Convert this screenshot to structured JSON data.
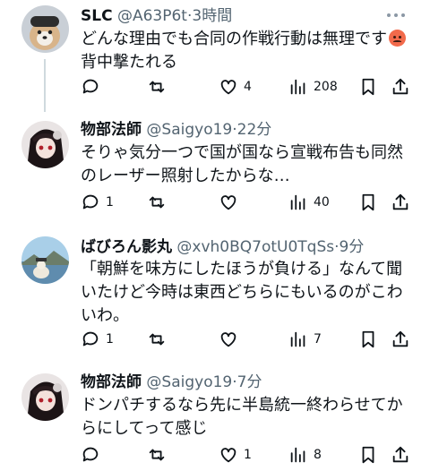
{
  "posts": [
    {
      "name": "SLC",
      "handle": "@A63P6t",
      "time": "3時間",
      "text_lines": [
        "どんな理由でも合同の作戦行動は無理です",
        "背中撃たれる"
      ],
      "emoji": "angry-face",
      "replies": "",
      "reposts": "",
      "likes": "4",
      "views": "208"
    },
    {
      "name": "物部法師",
      "handle": "@Saigyo19",
      "time": "22分",
      "text_lines": [
        "そりゃ気分一つで国が国なら宣戦布告も同然",
        "のレーザー照射したからな…"
      ],
      "replies": "1",
      "reposts": "",
      "likes": "",
      "views": "40"
    },
    {
      "name": "ばびろん影丸",
      "handle": "@xvh0BQ7otU0TqSs",
      "time": "9分",
      "text_lines": [
        "「朝鮮を味方にしたほうが負ける」なんて聞",
        "いたけど今時は東西どちらにもいるのがこわ",
        "いわ。"
      ],
      "replies": "1",
      "reposts": "",
      "likes": "",
      "views": "7"
    },
    {
      "name": "物部法師",
      "handle": "@Saigyo19",
      "time": "7分",
      "text_lines": [
        "ドンパチするなら先に半島統一終わらせてか",
        "らにしてって感じ"
      ],
      "replies": "",
      "reposts": "",
      "likes": "1",
      "views": "8"
    }
  ],
  "separator": "·",
  "colors": {
    "text": "#0f1419",
    "meta": "#536471",
    "thread_line": "#cfd9de",
    "emoji": "#f26a4b"
  },
  "icons": [
    "reply-icon",
    "repost-icon",
    "like-icon",
    "views-icon",
    "bookmark-icon",
    "share-icon",
    "more-icon"
  ]
}
